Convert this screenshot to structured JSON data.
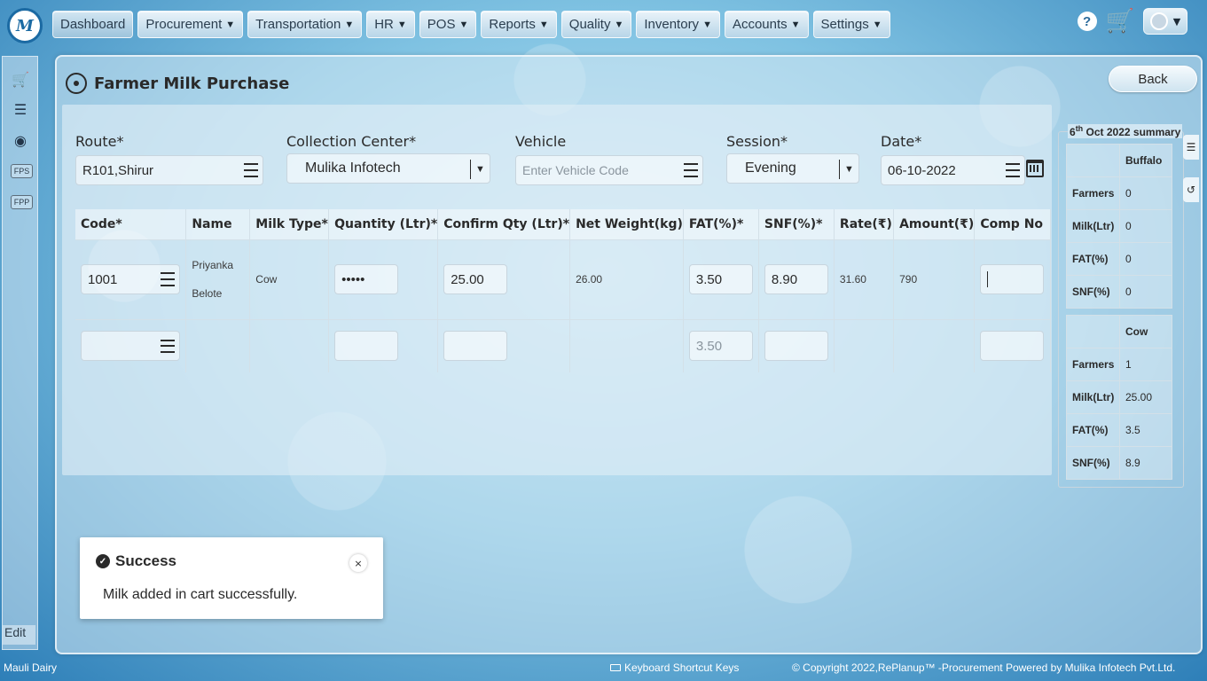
{
  "nav": {
    "items": [
      {
        "label": "Dashboard",
        "caret": ""
      },
      {
        "label": "Procurement",
        "caret": "▼"
      },
      {
        "label": "Transportation",
        "caret": "▼"
      },
      {
        "label": "HR",
        "caret": "▼"
      },
      {
        "label": "POS",
        "caret": "▼"
      },
      {
        "label": "Reports",
        "caret": "▼"
      },
      {
        "label": "Quality",
        "caret": "▼"
      },
      {
        "label": "Inventory",
        "caret": "▼"
      },
      {
        "label": "Accounts",
        "caret": "▼"
      },
      {
        "label": "Settings",
        "caret": "▼"
      }
    ],
    "help_glyph": "?",
    "cart_glyph": "🛒",
    "user_caret": "▼"
  },
  "sidebar": {
    "cart_glyph": "🛒",
    "list_glyph": "☰",
    "scale_glyph": "◉",
    "badge_1": "FPS",
    "badge_2": "FPP",
    "edit_label": "Edit"
  },
  "page": {
    "title": "Farmer Milk Purchase",
    "back_label": "Back"
  },
  "form": {
    "route": {
      "label": "Route*",
      "value": "R101,Shirur"
    },
    "center": {
      "label": "Collection Center*",
      "value": "Mulika Infotech"
    },
    "vehicle": {
      "label": "Vehicle",
      "placeholder": "Enter Vehicle Code"
    },
    "session": {
      "label": "Session*",
      "value": "Evening"
    },
    "date": {
      "label": "Date*",
      "value": "06-10-2022"
    }
  },
  "table": {
    "headers": [
      "Code*",
      "Name",
      "Milk Type*",
      "Quantity (Ltr)*",
      "Confirm Qty (Ltr)*",
      "Net Weight(kg)",
      "FAT(%)*",
      "SNF(%)*",
      "Rate(₹)",
      "Amount(₹)",
      "Comp No"
    ],
    "row1": {
      "code": "1001",
      "name_line1": "Priyanka",
      "name_line2": "Belote",
      "milk_type": "Cow",
      "quantity": "•••••",
      "confirm_qty": "25.00",
      "net_weight": "26.00",
      "fat": "3.50",
      "snf": "8.90",
      "rate": "31.60",
      "amount": "790"
    },
    "row2": {
      "fat_placeholder": "3.50"
    }
  },
  "summary": {
    "day": "6",
    "suffix": "th",
    "rest": " Oct 2022 summary",
    "buffalo": {
      "heading": "Buffalo",
      "rows": [
        {
          "label": "Farmers",
          "value": "0"
        },
        {
          "label": "Milk(Ltr)",
          "value": "0"
        },
        {
          "label": "FAT(%)",
          "value": "0"
        },
        {
          "label": "SNF(%)",
          "value": "0"
        }
      ]
    },
    "cow": {
      "heading": "Cow",
      "rows": [
        {
          "label": "Farmers",
          "value": "1"
        },
        {
          "label": "Milk(Ltr)",
          "value": "25.00"
        },
        {
          "label": "FAT(%)",
          "value": "3.5"
        },
        {
          "label": "SNF(%)",
          "value": "8.9"
        }
      ]
    }
  },
  "toast": {
    "title": "Success",
    "message": "Milk added in cart successfully.",
    "close_glyph": "×",
    "check_glyph": "✓"
  },
  "footer": {
    "company": "Mauli Dairy",
    "shortcut_label": "Keyboard Shortcut Keys",
    "copyright": "© Copyright 2022,RePlanup™ -Procurement Powered by Mulika Infotech Pvt.Ltd."
  },
  "colors": {
    "accent": "#1b6aa3",
    "panel": "#d6e9f4",
    "text": "#2a2a2a"
  }
}
